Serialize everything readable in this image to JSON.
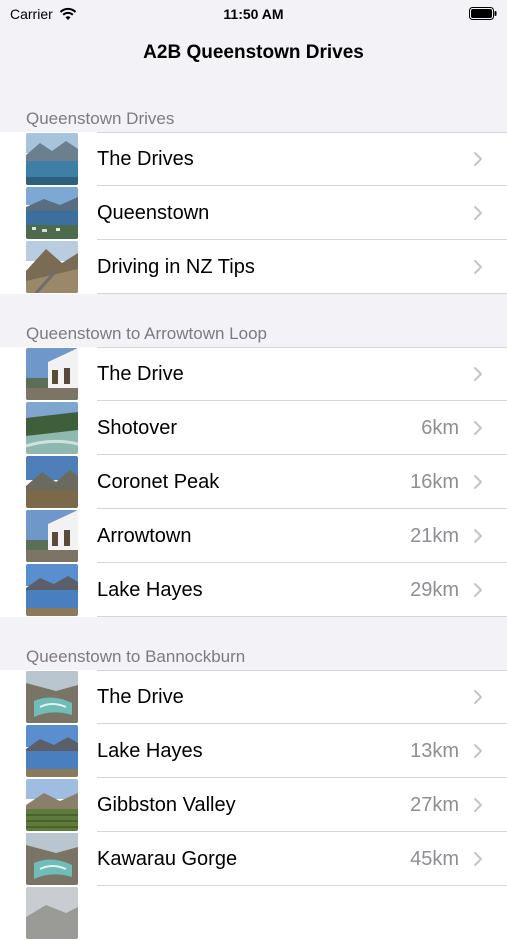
{
  "status_bar": {
    "carrier": "Carrier",
    "time": "11:50 AM"
  },
  "nav": {
    "title": "A2B Queenstown Drives"
  },
  "sections": [
    {
      "header": "Queenstown Drives",
      "rows": [
        {
          "label": "The Drives",
          "detail": "",
          "thumb": "lake-scene"
        },
        {
          "label": "Queenstown",
          "detail": "",
          "thumb": "town-aerial"
        },
        {
          "label": "Driving in NZ Tips",
          "detail": "",
          "thumb": "road-hills"
        }
      ]
    },
    {
      "header": "Queenstown to Arrowtown Loop",
      "rows": [
        {
          "label": "The Drive",
          "detail": "",
          "thumb": "heritage-building"
        },
        {
          "label": "Shotover",
          "detail": "6km",
          "thumb": "river-canyon"
        },
        {
          "label": "Coronet Peak",
          "detail": "16km",
          "thumb": "mountain-valley"
        },
        {
          "label": "Arrowtown",
          "detail": "21km",
          "thumb": "heritage-building"
        },
        {
          "label": "Lake Hayes",
          "detail": "29km",
          "thumb": "lake-reflection"
        }
      ]
    },
    {
      "header": "Queenstown to Bannockburn",
      "rows": [
        {
          "label": "The Drive",
          "detail": "",
          "thumb": "gorge-water"
        },
        {
          "label": "Lake Hayes",
          "detail": "13km",
          "thumb": "lake-reflection"
        },
        {
          "label": "Gibbston Valley",
          "detail": "27km",
          "thumb": "vineyard"
        },
        {
          "label": "Kawarau Gorge",
          "detail": "45km",
          "thumb": "gorge-water"
        }
      ]
    }
  ],
  "colors": {
    "background": "#f2f2f7",
    "cell": "#ffffff",
    "separator": "#d6d6da",
    "header_text": "#7b7b80",
    "detail_text": "#8e8e93",
    "chevron": "#c4c4c7"
  }
}
